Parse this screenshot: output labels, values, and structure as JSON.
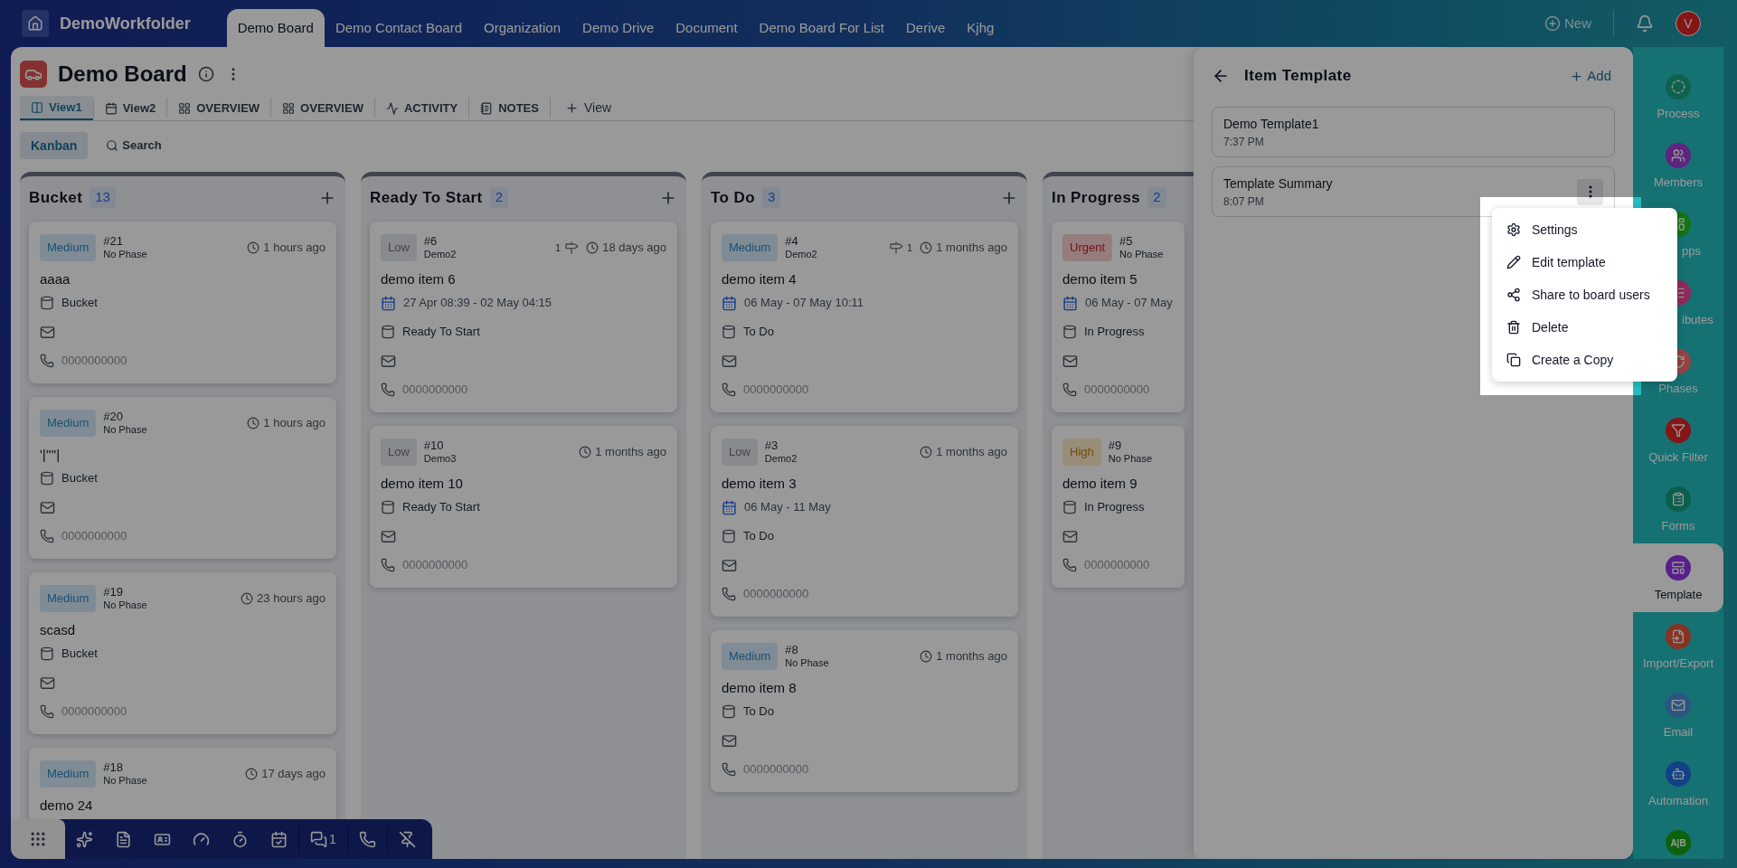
{
  "app": {
    "workspace": "DemoWorkfolder",
    "tabs": [
      {
        "label": "Demo Board",
        "selected": true
      },
      {
        "label": "Demo Contact Board",
        "selected": false
      },
      {
        "label": "Organization",
        "selected": false
      },
      {
        "label": "Demo Drive",
        "selected": false
      },
      {
        "label": "Document",
        "selected": false
      },
      {
        "label": "Demo Board For List",
        "selected": false
      },
      {
        "label": "Derive",
        "selected": false
      },
      {
        "label": "Kjhg",
        "selected": false
      }
    ],
    "new_label": "New",
    "avatar": "V"
  },
  "board": {
    "title": "Demo Board",
    "views": [
      {
        "label": "View1",
        "selected": true
      },
      {
        "label": "View2",
        "selected": false
      },
      {
        "label": "OVERVIEW",
        "selected": false
      },
      {
        "label": "OVERVIEW",
        "selected": false
      },
      {
        "label": "ACTIVITY",
        "selected": false
      },
      {
        "label": "NOTES",
        "selected": false
      }
    ],
    "add_view": "View",
    "modes": [
      {
        "label": "Kanban",
        "kind": "toggle",
        "selected": true
      },
      {
        "label": "Search",
        "kind": "search",
        "selected": false
      }
    ],
    "columns": [
      {
        "title": "Bucket",
        "count": "13",
        "can_add": true,
        "cards": [
          {
            "priority": {
              "label": "Medium",
              "kind": "medium"
            },
            "number": "#21",
            "phase": "No Phase",
            "time": "1 hours ago",
            "title": "aaaa",
            "bucket": "Bucket",
            "has_mail": true,
            "phone": "0000000000"
          },
          {
            "priority": {
              "label": "Medium",
              "kind": "medium"
            },
            "number": "#20",
            "phase": "No Phase",
            "time": "1 hours ago",
            "title": "'|''''|",
            "bucket": "Bucket",
            "has_mail": true,
            "phone": "0000000000"
          },
          {
            "priority": {
              "label": "Medium",
              "kind": "medium"
            },
            "number": "#19",
            "phase": "No Phase",
            "time": "23 hours ago",
            "title": "scasd",
            "bucket": "Bucket",
            "has_mail": true,
            "phone": "0000000000"
          },
          {
            "priority": {
              "label": "Medium",
              "kind": "medium"
            },
            "number": "#18",
            "phase": "No Phase",
            "time": "17 days ago",
            "title": "demo 24",
            "has_mail": false
          }
        ]
      },
      {
        "title": "Ready To Start",
        "count": "2",
        "can_add": true,
        "cards": [
          {
            "priority": {
              "label": "Low",
              "kind": "low"
            },
            "number": "#6",
            "phase": "Demo2",
            "subtasks": {
              "count": "1",
              "count_first": true
            },
            "time": "18 days ago",
            "title": "demo item 6",
            "dates": {
              "start": "27 Apr 08:39",
              "separator": "-",
              "end": "02 May 04:15"
            },
            "bucket": "Ready To Start",
            "has_mail": true,
            "phone": "0000000000"
          },
          {
            "priority": {
              "label": "Low",
              "kind": "low"
            },
            "number": "#10",
            "phase": "Demo3",
            "time": "1 months ago",
            "title": "demo item 10",
            "bucket": "Ready To Start",
            "has_mail": true,
            "phone": "0000000000"
          }
        ]
      },
      {
        "title": "To Do",
        "count": "3",
        "can_add": true,
        "cards": [
          {
            "priority": {
              "label": "Medium",
              "kind": "medium"
            },
            "number": "#4",
            "phase": "Demo2",
            "subtasks": {
              "count": "1",
              "count_first": false
            },
            "time": "1 months ago",
            "title": "demo item 4",
            "dates": {
              "start": "06 May",
              "separator": "-",
              "end": "07 May 10:11"
            },
            "bucket": "To Do",
            "has_mail": true,
            "phone": "0000000000"
          },
          {
            "priority": {
              "label": "Low",
              "kind": "low"
            },
            "number": "#3",
            "phase": "Demo2",
            "time": "1 months ago",
            "title": "demo item 3",
            "dates": {
              "start": "06 May",
              "separator": "-",
              "end": "11 May"
            },
            "bucket": "To Do",
            "has_mail": true,
            "phone": "0000000000"
          },
          {
            "priority": {
              "label": "Medium",
              "kind": "medium"
            },
            "number": "#8",
            "phase": "No Phase",
            "time": "1 months ago",
            "title": "demo item 8",
            "bucket": "To Do",
            "has_mail": true,
            "phone": "0000000000"
          }
        ]
      },
      {
        "title": "In Progress",
        "count": "2",
        "can_add": false,
        "cards": [
          {
            "priority": {
              "label": "Urgent",
              "kind": "urgent"
            },
            "number": "#5",
            "phase": "No Phase",
            "title": "demo item 5",
            "dates": {
              "start": "06 May",
              "separator": "-",
              "end": "07 May"
            },
            "bucket": "In Progress",
            "has_mail": true,
            "phone": "0000000000"
          },
          {
            "priority": {
              "label": "High",
              "kind": "high"
            },
            "number": "#9",
            "phase": "No Phase",
            "title": "demo item 9",
            "bucket": "In Progress",
            "has_mail": true,
            "phone": "0000000000"
          }
        ]
      }
    ]
  },
  "template_panel": {
    "title": "Item Template",
    "add_label": "Add",
    "templates": [
      {
        "name": "Demo Template1",
        "time": "7:37 PM",
        "menu_open": false
      },
      {
        "name": "Template Summary",
        "time": "8:07 PM",
        "menu_open": true
      }
    ],
    "menu": [
      {
        "label": "Settings"
      },
      {
        "label": "Edit template"
      },
      {
        "label": "Share to board users"
      },
      {
        "label": "Delete"
      },
      {
        "label": "Create a Copy"
      }
    ]
  },
  "sidebar": [
    {
      "label": "Process",
      "kind": "normal",
      "selected": false
    },
    {
      "label": "Members",
      "kind": "normal",
      "selected": false
    },
    {
      "label": "pps",
      "kind": "covered",
      "selected": false
    },
    {
      "label": "ibutes",
      "kind": "covered",
      "selected": false
    },
    {
      "label": "Phases",
      "kind": "normal",
      "selected": false
    },
    {
      "label": "Quick Filter",
      "kind": "normal",
      "selected": false
    },
    {
      "label": "Forms",
      "kind": "normal",
      "selected": false
    },
    {
      "label": "Template",
      "kind": "normal",
      "selected": true
    },
    {
      "label": "Import/Export",
      "kind": "normal",
      "selected": false
    },
    {
      "label": "Email",
      "kind": "normal",
      "selected": false
    },
    {
      "label": "Automation",
      "kind": "normal",
      "selected": false
    },
    {
      "badge": "A|B",
      "kind": "badge",
      "selected": false
    }
  ],
  "toolbar": [
    {
      "kind": "launcher"
    },
    {
      "kind": "tool"
    },
    {
      "kind": "tool"
    },
    {
      "kind": "tool"
    },
    {
      "kind": "tool"
    },
    {
      "kind": "tool"
    },
    {
      "kind": "tool"
    },
    {
      "kind": "tool",
      "count": "1"
    },
    {
      "kind": "tool"
    },
    {
      "kind": "tool"
    }
  ]
}
